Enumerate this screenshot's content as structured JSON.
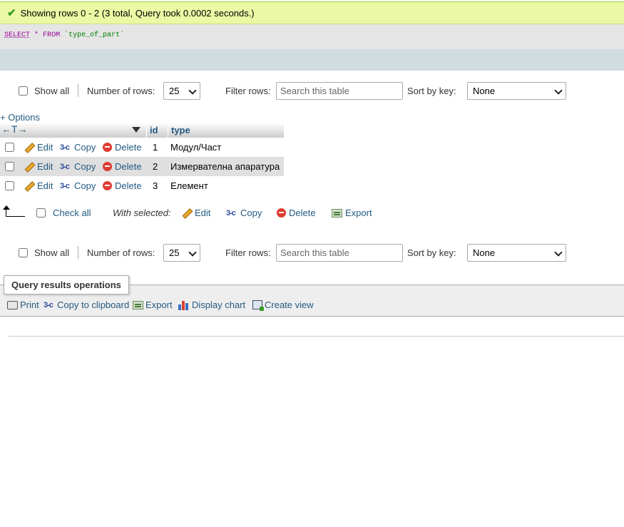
{
  "message": {
    "text": "Showing rows 0 - 2 (3 total, Query took 0.0002 seconds.)"
  },
  "sql": {
    "select": "SELECT",
    "star": "*",
    "from": "FROM",
    "table": "`type_of_part`"
  },
  "nav": {
    "show_all": "Show all",
    "number_of_rows_label": "Number of rows:",
    "number_of_rows_value": "25",
    "filter_label": "Filter rows:",
    "filter_placeholder": "Search this table",
    "sort_label": "Sort by key:",
    "sort_value": "None"
  },
  "options_label": "+ Options",
  "table": {
    "arrows": "←T→",
    "columns": [
      "id",
      "type"
    ],
    "actions": {
      "edit": "Edit",
      "copy": "Copy",
      "delete": "Delete"
    },
    "rows": [
      {
        "id": "1",
        "type": "Модул/Част"
      },
      {
        "id": "2",
        "type": "Измервателна апаратура"
      },
      {
        "id": "3",
        "type": "Елемент"
      }
    ]
  },
  "with_selected": {
    "check_all": "Check all",
    "label": "With selected:",
    "edit": "Edit",
    "copy": "Copy",
    "delete": "Delete",
    "export": "Export"
  },
  "query_ops": {
    "legend": "Query results operations",
    "print": "Print",
    "copy_clipboard": "Copy to clipboard",
    "export": "Export",
    "display_chart": "Display chart",
    "create_view": "Create view"
  },
  "colors": {
    "link": "#235a81",
    "success_bg": "#ebf8a4",
    "row_alt": "#dfdfdf"
  }
}
